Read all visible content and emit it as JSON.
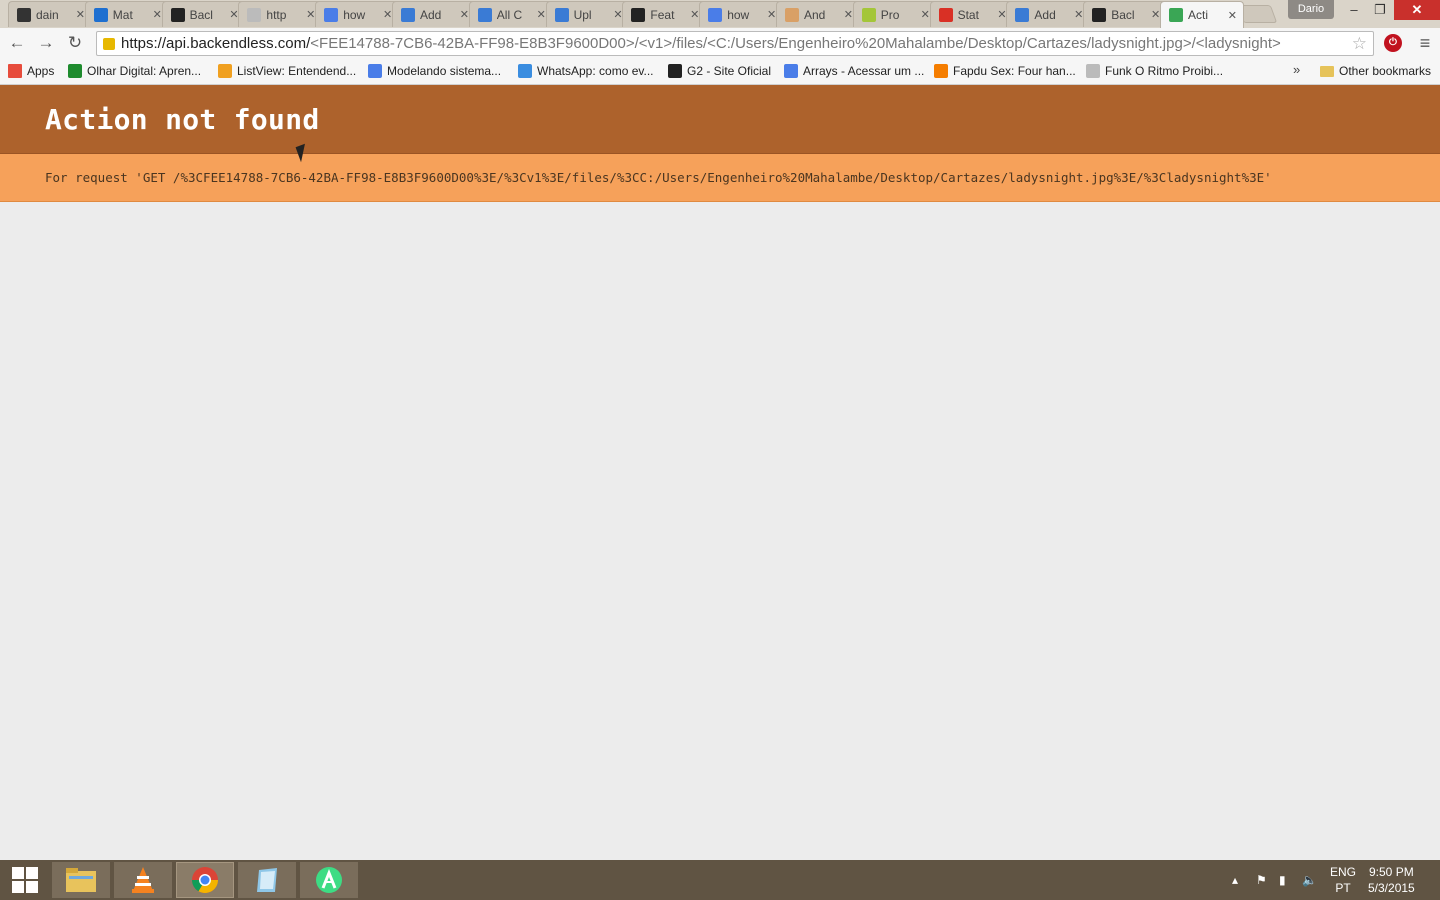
{
  "browser": {
    "tabs": [
      {
        "title": "dain",
        "fav_color": "#333333",
        "fav": "github-icon",
        "active": false
      },
      {
        "title": "Mat",
        "fav_color": "#1e6fd0",
        "fav": "browser-icon",
        "active": false
      },
      {
        "title": "Bacl",
        "fav_color": "#222222",
        "fav": "backendless-icon",
        "active": false
      },
      {
        "title": "http",
        "fav_color": "#bbbbbb",
        "fav": "page-icon",
        "active": false
      },
      {
        "title": "how",
        "fav_color": "#4a7de8",
        "fav": "google-icon",
        "active": false
      },
      {
        "title": "Add",
        "fav_color": "#3a7bd5",
        "fav": "ur-icon",
        "active": false
      },
      {
        "title": "All C",
        "fav_color": "#3a7bd5",
        "fav": "ur-icon",
        "active": false
      },
      {
        "title": "Upl",
        "fav_color": "#3a7bd5",
        "fav": "ur-icon",
        "active": false
      },
      {
        "title": "Feat",
        "fav_color": "#222222",
        "fav": "backendless-icon",
        "active": false
      },
      {
        "title": "how",
        "fav_color": "#4a7de8",
        "fav": "google-icon",
        "active": false
      },
      {
        "title": "And",
        "fav_color": "#d9a066",
        "fav": "stackoverflow-icon",
        "active": false
      },
      {
        "title": "Pro",
        "fav_color": "#a4c639",
        "fav": "android-icon",
        "active": false
      },
      {
        "title": "Stat",
        "fav_color": "#d93025",
        "fav": "gmail-icon",
        "active": false
      },
      {
        "title": "Add",
        "fav_color": "#3a7bd5",
        "fav": "ur-icon",
        "active": false
      },
      {
        "title": "Bacl",
        "fav_color": "#222222",
        "fav": "backendless-icon",
        "active": false
      },
      {
        "title": "Acti",
        "fav_color": "#3aa655",
        "fav": "play-icon",
        "active": true
      }
    ],
    "profile_name": "Dario",
    "url_host": "https://api.backendless.com/",
    "url_path": "<FEE14788-7CB6-42BA-FF98-E8B3F9600D00>/<v1>/files/<C:/Users/Engenheiro%20Mahalambe/Desktop/Cartazes/ladysnight.jpg>/<ladysnight>",
    "bookmarks": [
      {
        "label": "Apps",
        "icon": "apps-icon",
        "color": "#e74c3c"
      },
      {
        "label": "Olhar Digital: Apren...",
        "icon": "olhar-digital-icon",
        "color": "#1e8b2e"
      },
      {
        "label": "ListView: Entendend...",
        "icon": "listview-icon",
        "color": "#f0a020"
      },
      {
        "label": "Modelando sistema...",
        "icon": "google-icon",
        "color": "#4a7de8"
      },
      {
        "label": "WhatsApp: como ev...",
        "icon": "whatsapp-icon",
        "color": "#3a8de0"
      },
      {
        "label": "G2 - Site Oficial",
        "icon": "g2-icon",
        "color": "#222222"
      },
      {
        "label": "Arrays - Acessar um ...",
        "icon": "arrays-icon",
        "color": "#4a7de8"
      },
      {
        "label": "Fapdu Sex: Four han...",
        "icon": "blogger-icon",
        "color": "#f57d00"
      },
      {
        "label": "Funk O Ritmo Proibi...",
        "icon": "page-icon",
        "color": "#bbbbbb"
      }
    ],
    "bookmarks_more": "»",
    "other_bookmarks": "Other bookmarks"
  },
  "page": {
    "title": "Action not found",
    "detail": "For request 'GET /%3CFEE14788-7CB6-42BA-FF98-E8B3F9600D00%3E/%3Cv1%3E/files/%3CC:/Users/Engenheiro%20Mahalambe/Desktop/Cartazes/ladysnight.jpg%3E/%3Cladysnight%3E'"
  },
  "taskbar": {
    "lang_top": "ENG",
    "lang_bottom": "PT",
    "time": "9:50 PM",
    "date": "5/3/2015"
  }
}
